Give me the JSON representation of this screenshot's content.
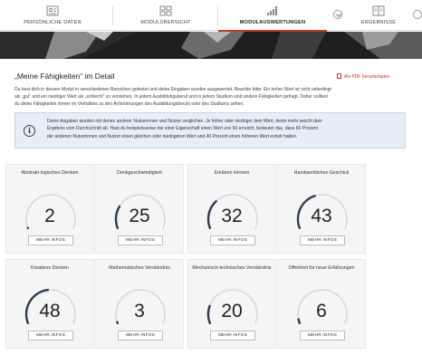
{
  "tabs": [
    {
      "label": "PERSÖNLICHE DATEN",
      "icon": "personal-data-icon"
    },
    {
      "label": "MODULÜBERSICHT",
      "icon": "module-overview-icon"
    },
    {
      "label": "MODULAUSWERTUNGEN",
      "icon": "bar-chart-icon",
      "active": true
    },
    {
      "label": "ERGEBNISSE",
      "icon": "results-icon"
    }
  ],
  "page": {
    "title": "„Meine Fähigkeiten“ im Detail",
    "pdf_link": "Als PDF herunterladen",
    "intro_lines": [
      "Du hast dich in diesem Modul in verschiedenen Bereichen getestet und deine Eingaben wurden ausgewertet. Beachte bitte: Ein hoher Wert ist nicht unbedingt",
      "als „gut“ und ein niedriger Wert als „schlecht“ zu verstehen. In jedem Ausbildungsberuf und in jedem Studium sind andere Fähigkeiten gefragt. Daher solltest",
      "du deine Fähigkeiten immer im Verhältnis zu den Anforderungen des Ausbildungsberufs oder des Studiums sehen."
    ],
    "info_lines": [
      "Deine Angaben wurden mit denen anderer Nutzerinnen und Nutzer verglichen. Je höher oder niedriger dein Wert, desto mehr weicht dein",
      "Ergebnis vom Durchschnitt ab. Hast du beispielsweise bei einer Eigenschaft einen Wert von 60 erreicht, bedeutet das, dass 60 Prozent",
      "der anderen Nutzerinnen und Nutzer einen gleichen oder niedrigeren Wert und 40 Prozent einen höheren Wert erzielt haben."
    ]
  },
  "button_label": "MEHR INFOS",
  "colors": {
    "accent": "#c0392b",
    "gauge_fill": "#2b3a4e",
    "gauge_track": "#d9d9d9",
    "info_bg": "#e8eef7"
  },
  "cards": [
    {
      "label": "Abstrakt-logisches Denken",
      "value": "2",
      "level": 0.02
    },
    {
      "label": "Denkgeschwindigkeit",
      "value": "25",
      "level": 0.25
    },
    {
      "label": "Erklären können",
      "value": "32",
      "level": 0.32
    },
    {
      "label": "Handwerkliches Geschick",
      "value": "43",
      "level": 0.43
    },
    {
      "label": "Kreatives Denken",
      "value": "48",
      "level": 0.48
    },
    {
      "label": "Mathematisches Verständnis",
      "value": "3",
      "level": 0.03
    },
    {
      "label": "Mechanisch-technisches Verständnis",
      "value": "20",
      "level": 0.2
    },
    {
      "label": "Offenheit für neue Erfahrungen",
      "value": "6",
      "level": 0.06
    }
  ]
}
